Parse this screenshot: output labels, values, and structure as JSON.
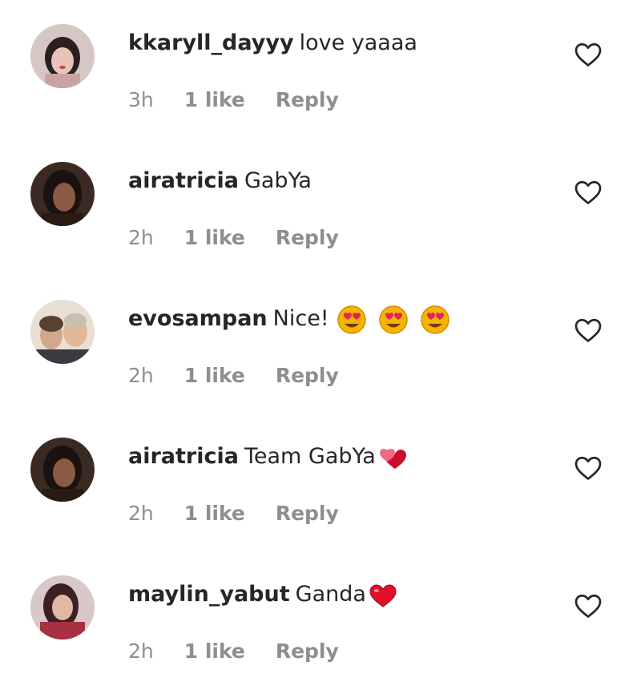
{
  "comments": [
    {
      "username": "kkaryll_dayyy",
      "text": "love yaaaa",
      "emoji": "",
      "time": "3h",
      "likes": "1 like",
      "reply": "Reply",
      "avatar_color": "#c9a3a0",
      "hair_color": "#2a2020"
    },
    {
      "username": "airatricia",
      "text": "GabYa",
      "emoji": "",
      "time": "2h",
      "likes": "1 like",
      "reply": "Reply",
      "avatar_color": "#6a4a3a",
      "hair_color": "#1a1210"
    },
    {
      "username": "evosampan",
      "text": "Nice!",
      "emoji": "star-struck-heart-eyes x3",
      "time": "2h",
      "likes": "1 like",
      "reply": "Reply",
      "avatar_color": "#d8c8b0",
      "hair_color": "#8a7050"
    },
    {
      "username": "airatricia",
      "text": "Team GabYa",
      "emoji": "two-hearts",
      "time": "2h",
      "likes": "1 like",
      "reply": "Reply",
      "avatar_color": "#6a4a3a",
      "hair_color": "#1a1210"
    },
    {
      "username": "maylin_yabut",
      "text": "Ganda",
      "emoji": "red-heart",
      "time": "2h",
      "likes": "1 like",
      "reply": "Reply",
      "avatar_color": "#b89090",
      "hair_color": "#3a2020"
    }
  ],
  "colors": {
    "meta": "#8e8e8e",
    "text": "#262626",
    "heart_emoji": "#e0245e"
  }
}
